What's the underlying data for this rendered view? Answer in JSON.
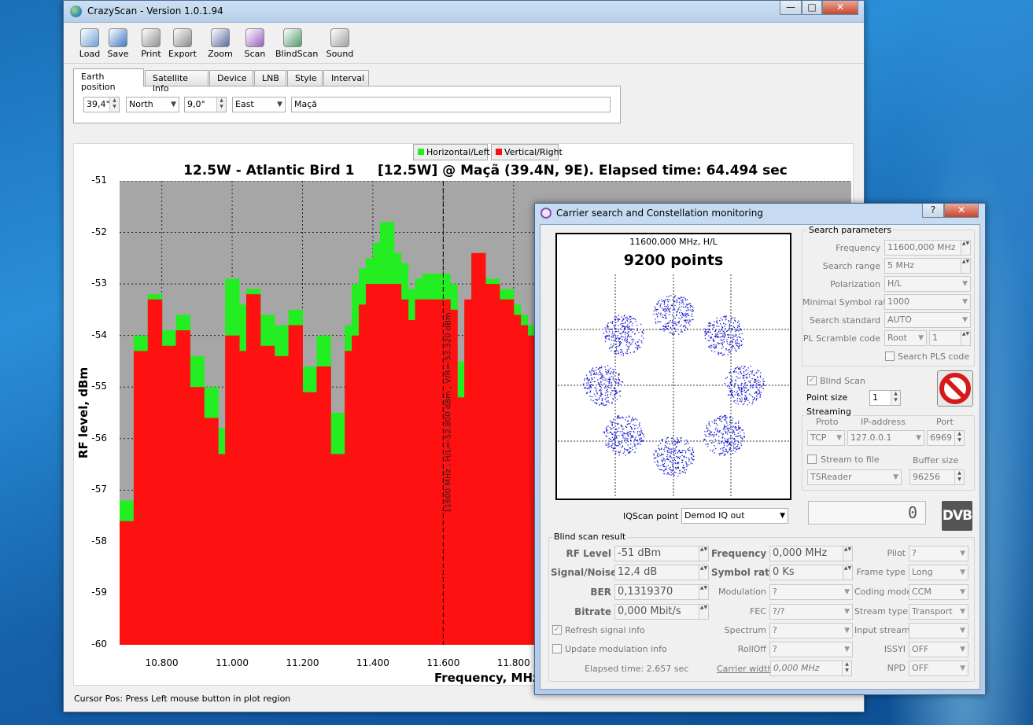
{
  "main_window": {
    "title": "CrazyScan - Version 1.0.1.94",
    "status": "Cursor Pos: Press Left mouse button in plot region"
  },
  "toolbar": [
    {
      "name": "load-button",
      "icon": "folder-icon",
      "label": "Load"
    },
    {
      "name": "save-button",
      "icon": "floppy-icon",
      "label": "Save"
    },
    {
      "name": "print-button",
      "icon": "printer-icon",
      "label": "Print"
    },
    {
      "name": "export-button",
      "icon": "export-printer-icon",
      "label": "Export"
    },
    {
      "name": "zoom-button",
      "icon": "zoom-icon",
      "label": "Zoom"
    },
    {
      "name": "scan-button",
      "icon": "magnifier-icon",
      "label": "Scan"
    },
    {
      "name": "blindscan-button",
      "icon": "satellite-icon",
      "label": "BlindScan"
    },
    {
      "name": "sound-button",
      "icon": "speaker-icon",
      "label": "Sound"
    }
  ],
  "tabs": [
    "Earth position",
    "Satellite info",
    "Device",
    "LNB",
    "Style",
    "Interval"
  ],
  "earth_position": {
    "latitude": "39,4°",
    "lat_dir": "North",
    "longitude": "9,0°",
    "lon_dir": "East",
    "location": "Maçã"
  },
  "legend": {
    "h": "Horizontal/Left",
    "v": "Vertical/Right",
    "h_color": "#22ee22",
    "v_color": "#ff1111"
  },
  "chart_data": {
    "type": "bar",
    "title": "12.5W - Atlantic Bird 1     [12.5W] @ Maçã (39.4N, 9E). Elapsed time: 64.494 sec",
    "xlabel": "Frequency, MHz",
    "ylabel": "RF level, dBm",
    "ylim": [
      -60,
      -51
    ],
    "y_ticks": [
      "-51",
      "-52",
      "-53",
      "-54",
      "-55",
      "-56",
      "-57",
      "-58",
      "-59",
      "-60"
    ],
    "x_ticks": [
      "10.800",
      "11.000",
      "11.200",
      "11.400",
      "11.600",
      "11.800"
    ],
    "cursor_label": "11600 MHz , H/L=-52.800 dBm , V/R=-53.320 dBm",
    "grid": true,
    "series": [
      {
        "name": "Horizontal/Left",
        "x": [
          10700,
          10740,
          10780,
          10820,
          10860,
          10900,
          10940,
          10980,
          11000,
          11020,
          11060,
          11100,
          11140,
          11180,
          11220,
          11260,
          11300,
          11320,
          11340,
          11360,
          11380,
          11400,
          11420,
          11440,
          11460,
          11480,
          11500,
          11520,
          11540,
          11560,
          11580,
          11600,
          11620,
          11640,
          11660,
          11680,
          11700,
          11740,
          11780,
          11800,
          11820,
          11840,
          11860
        ],
        "values": [
          -57.2,
          -54.0,
          -53.2,
          -53.9,
          -53.6,
          -54.4,
          -55.0,
          -55.8,
          -52.9,
          -53.4,
          -53.1,
          -53.6,
          -53.8,
          -53.5,
          -54.6,
          -54.0,
          -55.5,
          -57.2,
          -53.8,
          -53.0,
          -52.7,
          -52.5,
          -52.2,
          -51.8,
          -52.4,
          -52.6,
          -53.1,
          -53.8,
          -52.9,
          -52.8,
          -53.5,
          -52.8,
          -53.0,
          -54.5,
          -58.0,
          -53.5,
          -52.4,
          -52.9,
          -53.1,
          -53.4,
          -53.6,
          -53.8,
          -54.0
        ]
      },
      {
        "name": "Vertical/Right",
        "x": [
          10700,
          10740,
          10780,
          10820,
          10860,
          10900,
          10940,
          10980,
          11000,
          11020,
          11060,
          11100,
          11140,
          11180,
          11220,
          11260,
          11300,
          11320,
          11340,
          11360,
          11380,
          11400,
          11420,
          11440,
          11460,
          11480,
          11500,
          11520,
          11540,
          11560,
          11580,
          11600,
          11620,
          11640,
          11660,
          11680,
          11700,
          11740,
          11780,
          11800,
          11820,
          11840,
          11860
        ],
        "values": [
          -57.6,
          -54.3,
          -53.3,
          -54.2,
          -53.9,
          -55.0,
          -55.6,
          -56.3,
          -54.0,
          -54.3,
          -53.2,
          -54.2,
          -54.4,
          -53.8,
          -55.1,
          -54.6,
          -56.3,
          -58.0,
          -54.3,
          -54.0,
          -53.4,
          -53.0,
          -53.2,
          -53.0,
          -53.0,
          -53.3,
          -53.7,
          -54.4,
          -53.3,
          -53.3,
          -54.2,
          -53.3,
          -53.5,
          -55.2,
          -58.3,
          -53.3,
          -52.4,
          -53.0,
          -53.3,
          -53.6,
          -53.8,
          -54.0,
          -54.2
        ]
      }
    ]
  },
  "dialog": {
    "title": "Carrier search and Constellation monitoring",
    "help": "?",
    "close": "✕",
    "constellation_header": "11600,000 MHz, H/L",
    "points": "9200 points",
    "iq_label": "IQScan point",
    "iq_value": "Demod IQ out",
    "counter": "0",
    "search_params": {
      "title": "Search parameters",
      "frequency_label": "Frequency",
      "frequency": "11600,000 MHz",
      "range_label": "Search range",
      "range": "5 MHz",
      "polarization_label": "Polarization",
      "polarization": "H/L",
      "min_sr_label": "Minimal Symbol rate",
      "min_sr": "1000",
      "standard_label": "Search standard",
      "standard": "AUTO",
      "pls_label": "PL Scramble code",
      "pls_mode": "Root",
      "pls_value": "1",
      "search_pls": "Search PLS code"
    },
    "blind_scan": "Blind Scan",
    "point_size_label": "Point size",
    "point_size": "1",
    "streaming": {
      "title": "Streaming",
      "proto_label": "Proto",
      "proto": "TCP",
      "ip_label": "IP-address",
      "ip": "127.0.0.1",
      "port_label": "Port",
      "port": "6969",
      "stream_file": "Stream to file",
      "buffer_label": "Buffer size",
      "reader": "TSReader",
      "buffer": "96256"
    },
    "result": {
      "title": "Blind scan result",
      "rf_label": "RF Level",
      "rf": "-51 dBm",
      "sn_label": "Signal/Noise",
      "sn": "12,4 dB",
      "ber_label": "BER",
      "ber": "0,1319370",
      "bitrate_label": "Bitrate",
      "bitrate": "0,000 Mbit/s",
      "freq_label": "Frequency",
      "freq": "0,000 MHz",
      "sr_label": "Symbol rate",
      "sr": "0 Ks",
      "mod_label": "Modulation",
      "mod": "?",
      "fec_label": "FEC",
      "fec": "?/?",
      "spec_label": "Spectrum",
      "spec": "?",
      "roll_label": "RollOff",
      "roll": "?",
      "pilot_label": "Pilot",
      "pilot": "?",
      "frame_label": "Frame type",
      "frame": "Long",
      "coding_label": "Coding mode",
      "coding": "CCM",
      "stype_label": "Stream type",
      "stype": "Transport",
      "istream_label": "Input stream",
      "istream": "",
      "issyi_label": "ISSYI",
      "issyi": "OFF",
      "npd_label": "NPD",
      "npd": "OFF",
      "refresh": "Refresh signal info",
      "update": "Update modulation info",
      "elapsed": "Elapsed time: 2.657 sec",
      "carrier_label": "Carrier width",
      "carrier": "0,000 MHz"
    }
  }
}
